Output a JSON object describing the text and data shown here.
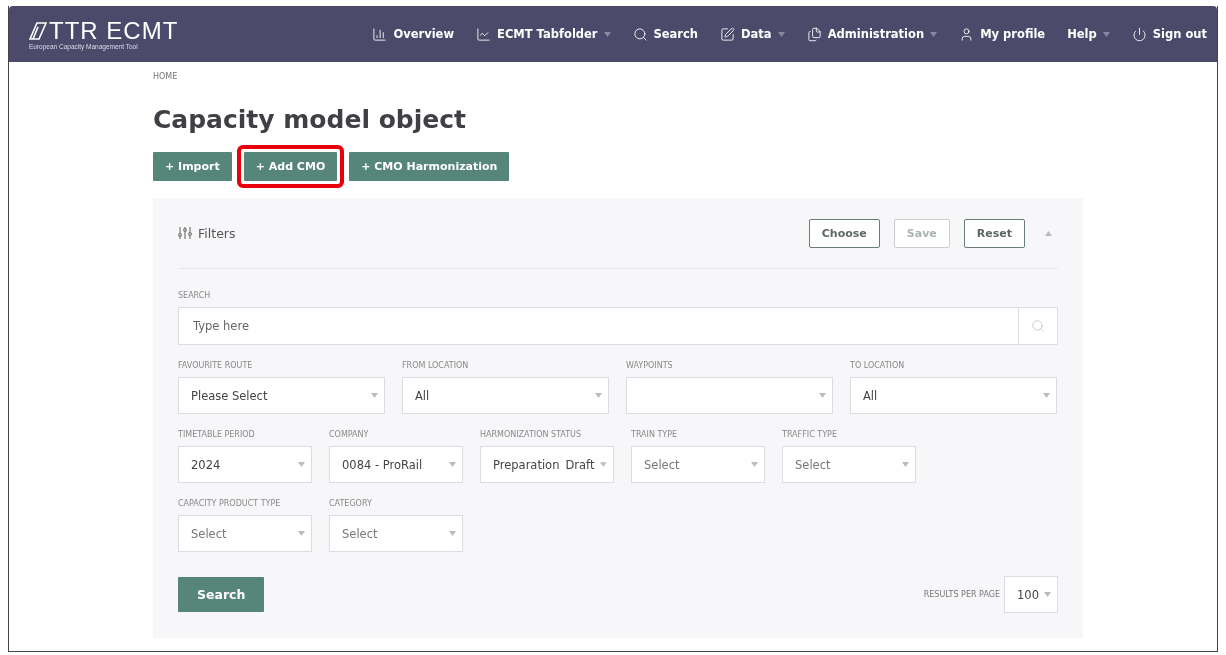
{
  "header": {
    "logo": {
      "title": "TTR ECMT",
      "subtitle": "European Capacity Management Tool"
    },
    "nav": [
      {
        "label": "Overview",
        "dropdown": false
      },
      {
        "label": "ECMT Tabfolder",
        "dropdown": true
      },
      {
        "label": "Search",
        "dropdown": false
      },
      {
        "label": "Data",
        "dropdown": true
      },
      {
        "label": "Administration",
        "dropdown": true
      },
      {
        "label": "My profile",
        "dropdown": false
      },
      {
        "label": "Help",
        "dropdown": true
      },
      {
        "label": "Sign out",
        "dropdown": false
      }
    ]
  },
  "breadcrumb": "HOME",
  "title": "Capacity model object",
  "actions": [
    {
      "label": "+ Import",
      "highlighted": false
    },
    {
      "label": "+ Add CMO",
      "highlighted": true
    },
    {
      "label": "+ CMO Harmonization",
      "highlighted": false
    }
  ],
  "filters": {
    "title": "Filters",
    "expanded": true,
    "buttons": [
      {
        "label": "Choose",
        "disabled": false
      },
      {
        "label": "Save",
        "disabled": true
      },
      {
        "label": "Reset",
        "disabled": false
      }
    ],
    "search": {
      "label": "SEARCH",
      "placeholder": "Type here"
    },
    "field_groups": [
      {
        "fields": [
          {
            "label": "FAVOURITE ROUTE",
            "value": "Please Select"
          },
          {
            "label": "FROM LOCATION",
            "value": "All"
          },
          {
            "label": "WAYPOINTS"
          },
          {
            "label": "TO LOCATION",
            "value": "All"
          }
        ]
      },
      {
        "fields": [
          {
            "label": "TIMETABLE PERIOD",
            "value": "2024"
          },
          {
            "label": "COMPANY",
            "value": "0084 - ProRail"
          },
          {
            "label": "HARMONIZATION STATUS",
            "values": [
              "Preparation",
              "Draft"
            ]
          },
          {
            "label": "TRAIN TYPE",
            "placeholder": "Select"
          },
          {
            "label": "TRAFFIC TYPE",
            "placeholder": "Select"
          }
        ]
      },
      {
        "fields": [
          {
            "label": "CAPACITY PRODUCT TYPE",
            "placeholder": "Select"
          },
          {
            "label": "CATEGORY",
            "placeholder": "Select"
          }
        ]
      }
    ],
    "submit": "Search",
    "results_per_page": {
      "label": "RESULTS PER PAGE",
      "value": "100"
    }
  }
}
